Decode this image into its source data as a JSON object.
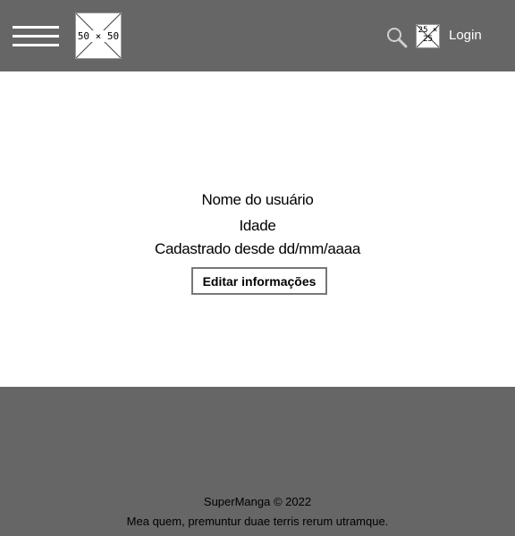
{
  "header": {
    "logo_placeholder": "50 × 50",
    "avatar_placeholder": "25 × 25",
    "login_label": "Login"
  },
  "profile": {
    "username": "Nome do usuário",
    "age": "Idade",
    "registered_since": "Cadastrado desde dd/mm/aaaa",
    "edit_button_label": "Editar informações"
  },
  "footer": {
    "copyright": "SuperManga © 2022",
    "tagline": "Mea quem, premuntur duae terris rerum utramque."
  },
  "colors": {
    "header_bg": "#666666",
    "footer_bg": "#666666",
    "main_bg": "#ffffff"
  },
  "icons": [
    "menu-icon",
    "search-icon"
  ]
}
